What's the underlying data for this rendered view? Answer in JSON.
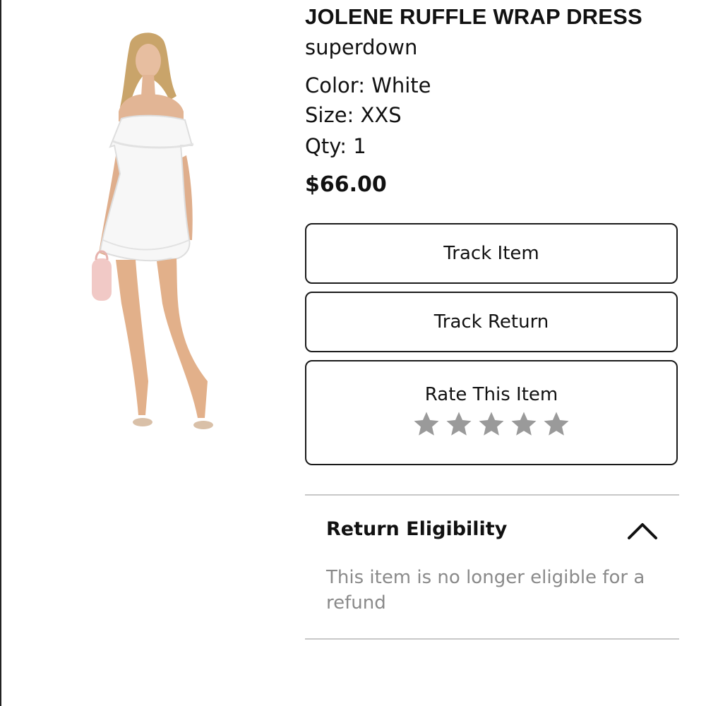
{
  "product": {
    "name": "JOLENE RUFFLE WRAP DRESS",
    "brand": "superdown",
    "color": "Color: White",
    "size": "Size: XXS",
    "qty": "Qty: 1",
    "price": "$66.00"
  },
  "actions": {
    "track_item": "Track Item",
    "track_return": "Track Return",
    "rate_item": "Rate This Item",
    "rating": {
      "value": 0,
      "max": 5,
      "star_color": "#9a9a9a"
    }
  },
  "return_eligibility": {
    "title": "Return Eligibility",
    "expanded": true,
    "icon": "chevron-up-icon",
    "message": "This item is no longer eligible for a refund"
  }
}
